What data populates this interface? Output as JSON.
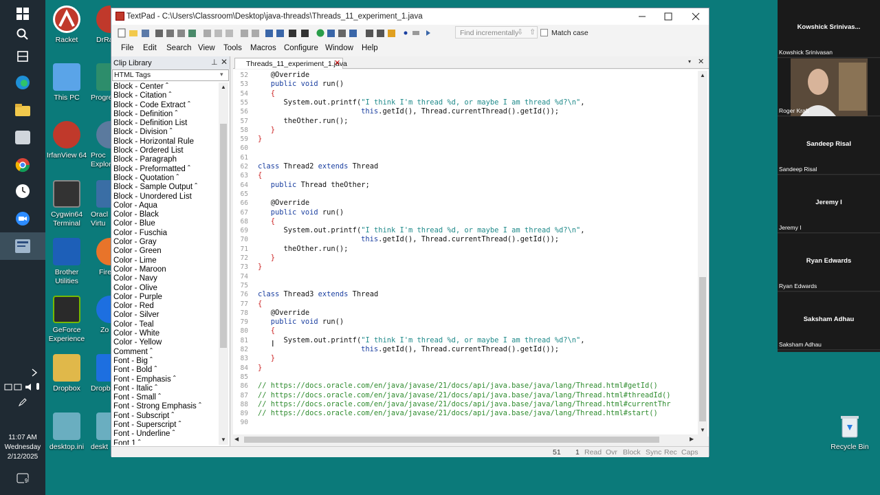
{
  "taskbar": {
    "clock_time": "11:07 AM",
    "clock_day": "Wednesday",
    "clock_date": "2/12/2025",
    "notification_count": "9"
  },
  "desktop_icons": [
    {
      "label": "Racket",
      "color": "#c0392b"
    },
    {
      "label": "This PC",
      "color": "#2f7ed8"
    },
    {
      "label": "IrfanView 64",
      "color": "#c0392b"
    },
    {
      "label": "Cygwin64 Terminal",
      "color": "#333333"
    },
    {
      "label": "Brother Utilities",
      "color": "#1d5fb8"
    },
    {
      "label": "GeForce Experience",
      "color": "#2a2a2a"
    },
    {
      "label": "Dropbox",
      "color": "#e0b84a"
    },
    {
      "label": "desktop.ini",
      "color": "#6aaec0"
    }
  ],
  "desktop_icons_partial": [
    {
      "label": "DrRa",
      "color": "#c0392b"
    },
    {
      "label": "Progre",
      "color": "#2d8d6b"
    },
    {
      "label": "Proc Explor",
      "color": "#5b7a9e"
    },
    {
      "label": "Oracl Virtu",
      "color": "#3a6ea5"
    },
    {
      "label": "Fire",
      "color": "#e8742a"
    },
    {
      "label": "Zo",
      "color": "#1d6fe0"
    },
    {
      "label": "Dropb",
      "color": "#1d6fe0"
    },
    {
      "label": "deskt",
      "color": "#6aaec0"
    }
  ],
  "recycle_bin": {
    "label": "Recycle Bin"
  },
  "window": {
    "title": "TextPad - C:\\Users\\Classroom\\Desktop\\java-threads\\Threads_11_experiment_1.java",
    "find_placeholder": "Find incrementally",
    "match_case_label": "Match case",
    "menu": [
      "File",
      "Edit",
      "Search",
      "View",
      "Tools",
      "Macros",
      "Configure",
      "Window",
      "Help"
    ]
  },
  "clip_library": {
    "title": "Clip Library",
    "selected": "HTML Tags",
    "items": [
      "Block - Center ˆ",
      "Block - Citation ˆ",
      "Block - Code Extract ˆ",
      "Block - Definition ˆ",
      "Block - Definition List",
      "Block - Division ˆ",
      "Block - Horizontal Rule",
      "Block - Ordered List",
      "Block - Paragraph",
      "Block - Preformatted ˆ",
      "Block - Quotation ˆ",
      "Block - Sample Output ˆ",
      "Block - Unordered List",
      "Color - Aqua",
      "Color - Black",
      "Color - Blue",
      "Color - Fuschia",
      "Color - Gray",
      "Color - Green",
      "Color - Lime",
      "Color - Maroon",
      "Color - Navy",
      "Color - Olive",
      "Color - Purple",
      "Color - Red",
      "Color - Silver",
      "Color - Teal",
      "Color - White",
      "Color - Yellow",
      "Comment ˆ",
      "Font - Big ˆ",
      "Font - Bold ˆ",
      "Font - Emphasis ˆ",
      "Font - Italic ˆ",
      "Font - Small ˆ",
      "Font - Strong Emphasis ˆ",
      "Font - Subscript ˆ",
      "Font - Superscript ˆ",
      "Font - Underline ˆ",
      "Font 1 ˆ"
    ]
  },
  "tab": {
    "label": "Threads_11_experiment_1.java"
  },
  "code": {
    "lines": [
      {
        "n": "52",
        "t": "   @Override"
      },
      {
        "n": "53",
        "t": "   public void run()"
      },
      {
        "n": "54",
        "t": "   {"
      },
      {
        "n": "55",
        "t": "      System.out.printf(\"I think I'm thread %d, or maybe I am thread %d?\\n\","
      },
      {
        "n": "56",
        "t": "                        this.getId(), Thread.currentThread().getId());"
      },
      {
        "n": "57",
        "t": "      theOther.run();"
      },
      {
        "n": "58",
        "t": "   }"
      },
      {
        "n": "59",
        "t": "}"
      },
      {
        "n": "60",
        "t": ""
      },
      {
        "n": "61",
        "t": ""
      },
      {
        "n": "62",
        "t": "class Thread2 extends Thread"
      },
      {
        "n": "63",
        "t": "{"
      },
      {
        "n": "64",
        "t": "   public Thread theOther;"
      },
      {
        "n": "65",
        "t": ""
      },
      {
        "n": "66",
        "t": "   @Override"
      },
      {
        "n": "67",
        "t": "   public void run()"
      },
      {
        "n": "68",
        "t": "   {"
      },
      {
        "n": "69",
        "t": "      System.out.printf(\"I think I'm thread %d, or maybe I am thread %d?\\n\","
      },
      {
        "n": "70",
        "t": "                        this.getId(), Thread.currentThread().getId());"
      },
      {
        "n": "71",
        "t": "      theOther.run();"
      },
      {
        "n": "72",
        "t": "   }"
      },
      {
        "n": "73",
        "t": "}"
      },
      {
        "n": "74",
        "t": ""
      },
      {
        "n": "75",
        "t": ""
      },
      {
        "n": "76",
        "t": "class Thread3 extends Thread"
      },
      {
        "n": "77",
        "t": "{"
      },
      {
        "n": "78",
        "t": "   @Override"
      },
      {
        "n": "79",
        "t": "   public void run()"
      },
      {
        "n": "80",
        "t": "   {"
      },
      {
        "n": "81",
        "t": "      System.out.printf(\"I think I'm thread %d, or maybe I am thread %d?\\n\","
      },
      {
        "n": "82",
        "t": "                        this.getId(), Thread.currentThread().getId());"
      },
      {
        "n": "83",
        "t": "   }"
      },
      {
        "n": "84",
        "t": "}"
      },
      {
        "n": "85",
        "t": ""
      },
      {
        "n": "86",
        "t": "// https://docs.oracle.com/en/java/javase/21/docs/api/java.base/java/lang/Thread.html#getId()"
      },
      {
        "n": "87",
        "t": "// https://docs.oracle.com/en/java/javase/21/docs/api/java.base/java/lang/Thread.html#threadId()"
      },
      {
        "n": "88",
        "t": "// https://docs.oracle.com/en/java/javase/21/docs/api/java.base/java/lang/Thread.html#currentThr"
      },
      {
        "n": "89",
        "t": "// https://docs.oracle.com/en/java/javase/21/docs/api/java.base/java/lang/Thread.html#start()"
      },
      {
        "n": "90",
        "t": ""
      }
    ]
  },
  "status": {
    "line": "51",
    "col": "1",
    "flags": [
      "Read",
      "Ovr",
      "Block",
      "Sync",
      "Rec",
      "Caps"
    ]
  },
  "participants": [
    {
      "name": "Kowshick Srinivas...",
      "full": "Kowshick Srinivasan",
      "video": false
    },
    {
      "name": "Roger Kraft",
      "full": "Roger Kraft",
      "video": true
    },
    {
      "name": "Sandeep Risal",
      "full": "Sandeep Risal",
      "video": false
    },
    {
      "name": "Jeremy I",
      "full": "Jeremy I",
      "video": false
    },
    {
      "name": "Ryan Edwards",
      "full": "Ryan Edwards",
      "video": false
    },
    {
      "name": "Saksham Adhau",
      "full": "Saksham Adhau",
      "video": false
    }
  ]
}
